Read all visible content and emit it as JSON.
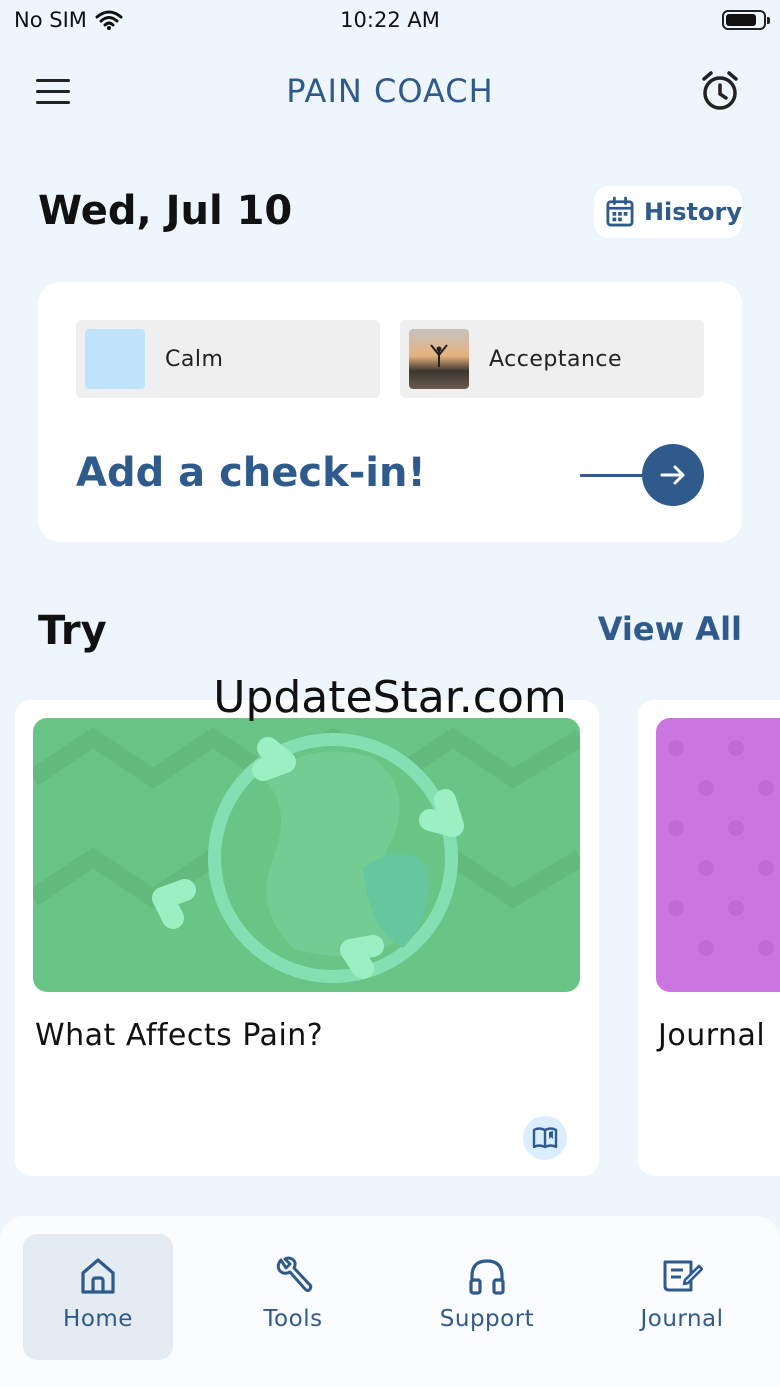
{
  "status_bar": {
    "carrier": "No SIM",
    "time": "10:22 AM"
  },
  "header": {
    "title": "PAIN COACH"
  },
  "date": "Wed, Jul 10",
  "history_button": {
    "label": "History"
  },
  "checkin": {
    "chips": [
      {
        "label": "Calm"
      },
      {
        "label": "Acceptance"
      }
    ],
    "prompt": "Add a check-in!"
  },
  "try_section": {
    "title": "Try",
    "view_all": "View All"
  },
  "watermark": "UpdateStar.com",
  "activities": [
    {
      "title": "What Affects Pain?",
      "type_icon": "book-icon"
    },
    {
      "title": "Journal"
    }
  ],
  "tabs": [
    {
      "label": "Home",
      "icon": "home-icon",
      "active": true
    },
    {
      "label": "Tools",
      "icon": "wrench-icon",
      "active": false
    },
    {
      "label": "Support",
      "icon": "headphones-icon",
      "active": false
    },
    {
      "label": "Journal",
      "icon": "journal-icon",
      "active": false
    }
  ],
  "colors": {
    "accent": "#2f5a8c",
    "background": "#eef5fd",
    "card_green": "#68c585",
    "card_purple": "#cb76e0",
    "calm_swatch": "#bee3fa"
  }
}
